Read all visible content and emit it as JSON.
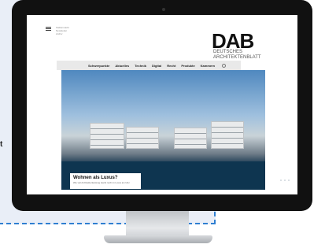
{
  "background": {
    "side_text": "t"
  },
  "site": {
    "meta_links": [
      "Stellenmarkt",
      "Newsletter",
      "Archiv"
    ],
    "logo": "DAB",
    "logo_sub_1": "DEUTSCHES",
    "logo_sub_2": "ARCHITEKTENBLATT",
    "nav": [
      "Schwerpunkte",
      "Aktuelles",
      "Technik",
      "Digital",
      "Recht",
      "Produkte",
      "Kammern"
    ],
    "hero": {
      "title": "Wohnen als Luxus?",
      "teaser": "Wie viel Architektenleistung steckt noch im Luxus am Ufer"
    }
  },
  "colors": {
    "accent": "#2f7fd1",
    "monitor": "#111111"
  }
}
